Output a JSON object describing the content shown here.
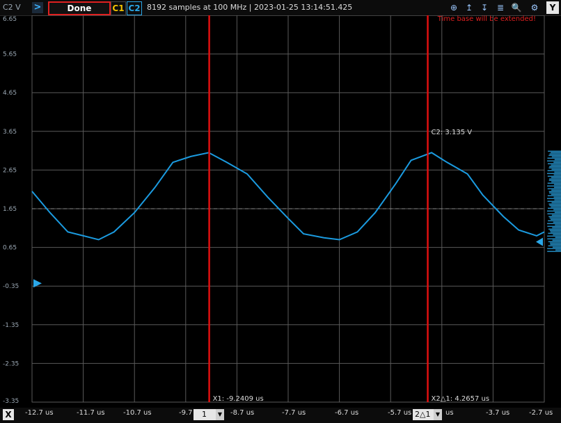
{
  "toolbar": {
    "axis_label": "C2 V",
    "expand_glyph": ">",
    "done_label": "Done",
    "ch1_label": "C1",
    "ch2_label": "C2",
    "status": "8192 samples at 100 MHz | 2023-01-25 13:14:51.425",
    "y_label": "Y",
    "tools": [
      {
        "name": "zoom-fit-icon",
        "glyph": "⊕"
      },
      {
        "name": "cursor-up-icon",
        "glyph": "↥"
      },
      {
        "name": "cursor-down-icon",
        "glyph": "↧"
      },
      {
        "name": "cursor-lines-icon",
        "glyph": "≣"
      },
      {
        "name": "magnifier-icon",
        "glyph": "🔍"
      },
      {
        "name": "settings-icon",
        "glyph": "⚙"
      }
    ]
  },
  "warning": "Time base will be extended!",
  "colors": {
    "trace": "#1b9be0",
    "cursor": "#e01010",
    "grid": "#5a5a5a",
    "trigger": "#2aa7e8"
  },
  "chart_data": {
    "type": "line",
    "y_ticks": [
      "6.65",
      "5.65",
      "4.65",
      "3.65",
      "2.65",
      "1.65",
      "0.65",
      "-0.35",
      "-1.35",
      "-2.35",
      "-3.35"
    ],
    "x_ticks": [
      "-12.7 us",
      "-11.7 us",
      "-10.7 us",
      "-9.7",
      "1",
      "-8.7 us",
      "-7.7 us",
      "-6.7 us",
      "-5.7 us",
      "2△1",
      "us",
      "-3.7 us",
      "-2.7 us"
    ],
    "ylim": [
      -3.35,
      6.65
    ],
    "xlim": [
      -12.7,
      -2.7
    ],
    "series": [
      {
        "points": [
          [
            -12.7,
            2.1
          ],
          [
            -12.35,
            1.55
          ],
          [
            -12.0,
            1.05
          ],
          [
            -11.7,
            0.95
          ],
          [
            -11.4,
            0.85
          ],
          [
            -11.1,
            1.05
          ],
          [
            -10.7,
            1.55
          ],
          [
            -10.3,
            2.2
          ],
          [
            -9.95,
            2.85
          ],
          [
            -9.6,
            3.0
          ],
          [
            -9.25,
            3.1
          ],
          [
            -8.9,
            2.85
          ],
          [
            -8.5,
            2.55
          ],
          [
            -8.1,
            1.95
          ],
          [
            -7.7,
            1.4
          ],
          [
            -7.4,
            1.0
          ],
          [
            -7.0,
            0.9
          ],
          [
            -6.7,
            0.85
          ],
          [
            -6.35,
            1.05
          ],
          [
            -6.0,
            1.55
          ],
          [
            -5.6,
            2.3
          ],
          [
            -5.3,
            2.9
          ],
          [
            -4.9,
            3.1
          ],
          [
            -4.6,
            2.85
          ],
          [
            -4.2,
            2.55
          ],
          [
            -3.9,
            2.0
          ],
          [
            -3.5,
            1.45
          ],
          [
            -3.2,
            1.1
          ],
          [
            -2.85,
            0.95
          ],
          [
            -2.7,
            1.05
          ]
        ]
      }
    ],
    "cursors": [
      {
        "x": -9.2409,
        "label": "X1: -9.2409 us"
      },
      {
        "x": -4.9752,
        "label": "X2△1: 4.2657 us"
      }
    ],
    "value_label": "C2: 3.135 V",
    "dashed_level": 1.65
  },
  "xaxis": {
    "x_label": "X",
    "dropdown1": "1",
    "dropdown2": "2△1"
  }
}
